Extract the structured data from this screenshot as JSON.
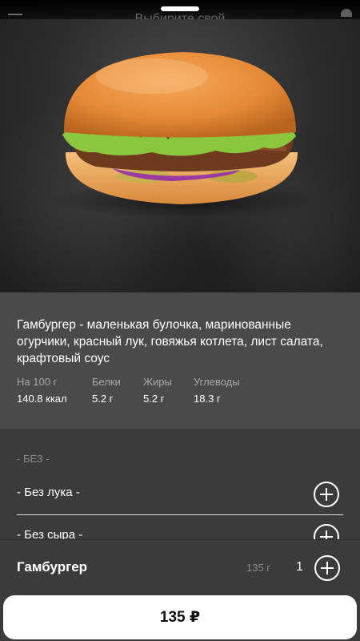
{
  "header": {
    "title": "Выбирите свой"
  },
  "product": {
    "description": "Гамбургер - маленькая булочка, маринованные огурчики, красный лук, говяжья котлета, лист салата, крафтовый соус",
    "nutrition": [
      {
        "label": "На 100 г",
        "value": "140.8 ккал"
      },
      {
        "label": "Белки",
        "value": "5.2 г"
      },
      {
        "label": "Жиры",
        "value": "5.2 г"
      },
      {
        "label": "Углеводы",
        "value": "18.3 г"
      }
    ]
  },
  "options": {
    "section_title": "- БЕЗ -",
    "items": [
      {
        "label": "- Без лука -"
      },
      {
        "label": "- Без сыра -"
      }
    ]
  },
  "bottom": {
    "name": "Гамбургер",
    "weight": "135 г",
    "quantity": "1"
  },
  "order_button": {
    "label": "135 ₽"
  },
  "icons": [
    "menu-icon",
    "cart-icon",
    "plus-icon"
  ]
}
